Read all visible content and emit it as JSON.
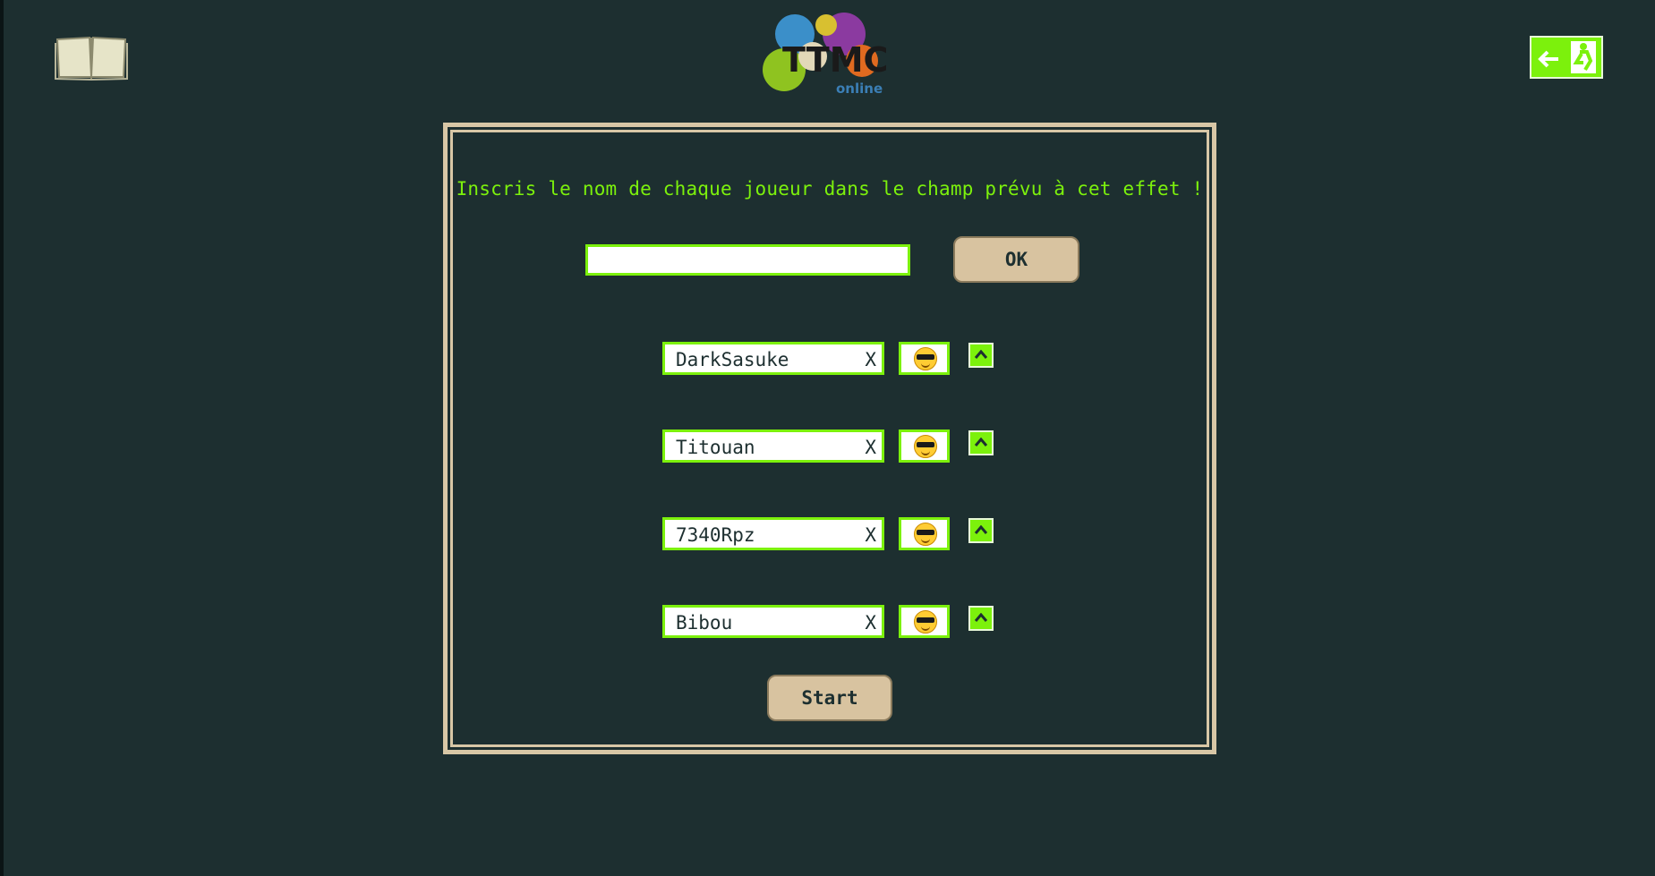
{
  "app": {
    "logo_icon": "ttmc-online-logo",
    "rules_icon": "open-book-icon",
    "exit_icon": "emergency-exit-icon"
  },
  "colors": {
    "background": "#1d2f30",
    "accent": "#7cf10c",
    "panel_border": "#d8c7a6",
    "button_bg": "#d8c3a0"
  },
  "form": {
    "instruction": "Inscris le nom de chaque joueur dans le champ prévu à cet effet !",
    "name_input_value": "",
    "ok_label": "OK"
  },
  "players": [
    {
      "name": "DarkSasuke",
      "remove_label": "X",
      "avatar_icon": "sunglasses-emoji-icon"
    },
    {
      "name": "Titouan",
      "remove_label": "X",
      "avatar_icon": "sunglasses-emoji-icon"
    },
    {
      "name": "7340Rpz",
      "remove_label": "X",
      "avatar_icon": "sunglasses-emoji-icon"
    },
    {
      "name": "Bibou",
      "remove_label": "X",
      "avatar_icon": "sunglasses-emoji-icon"
    }
  ],
  "start_label": "Start"
}
